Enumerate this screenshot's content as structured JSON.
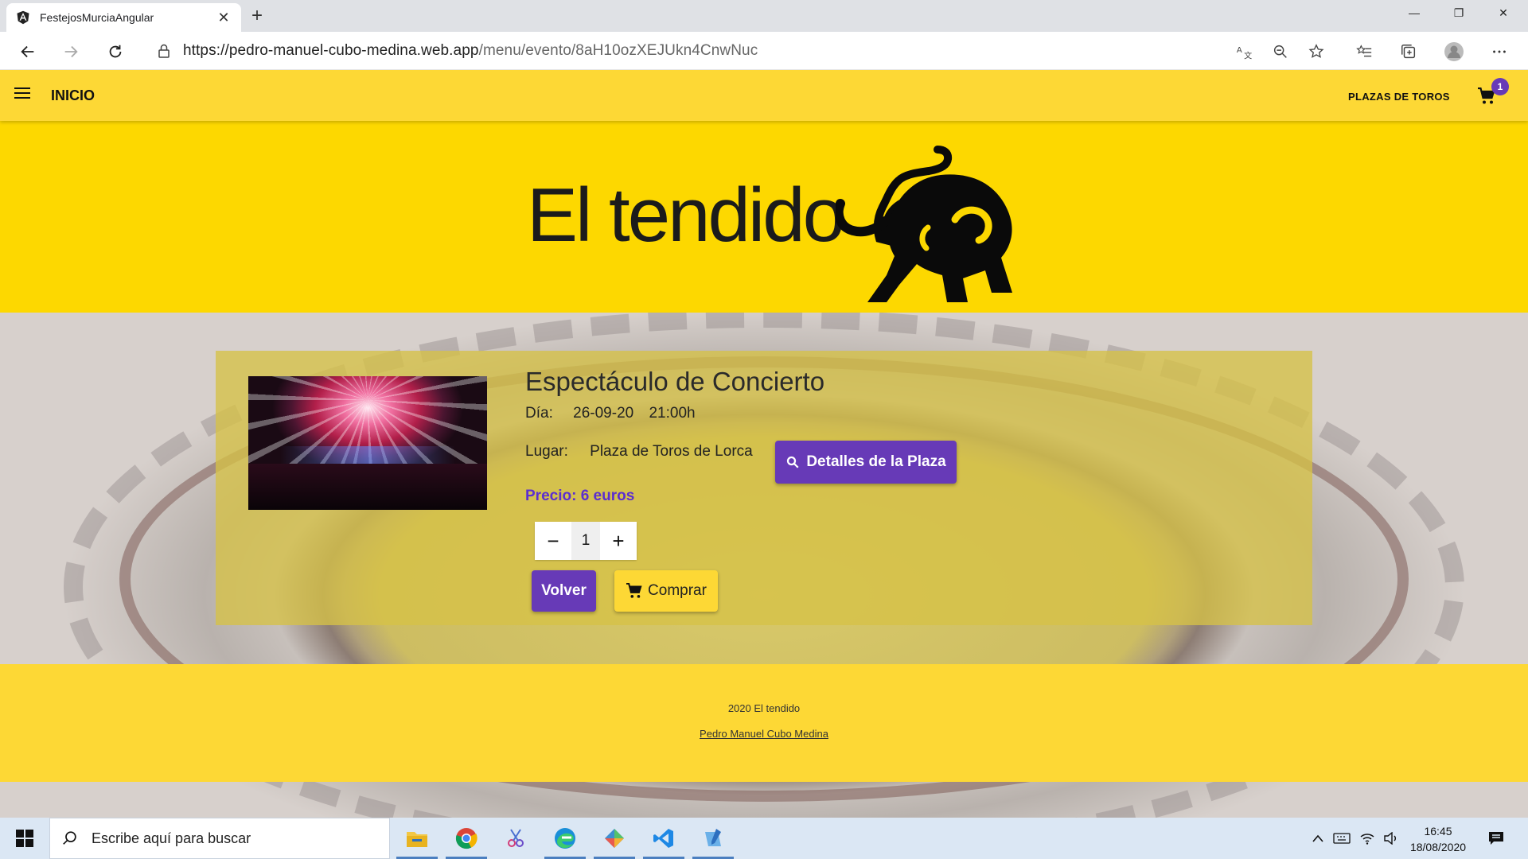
{
  "browser": {
    "tab_title": "FestejosMurciaAngular",
    "url_host": "https://pedro-manuel-cubo-medina.web.app",
    "url_path": "/menu/evento/8aH10ozXEJUkn4CnwNuc"
  },
  "site": {
    "nav": {
      "home_label": "INICIO",
      "plazas_label": "PLAZAS DE TOROS",
      "cart_count": "1"
    },
    "hero": {
      "logo_text": "El tendido"
    },
    "event": {
      "title": "Espectáculo de Concierto",
      "dia_label": "Día:",
      "date": "26-09-20",
      "time": "21:00h",
      "lugar_label": "Lugar:",
      "place": "Plaza de Toros de Lorca",
      "details_button": "Detalles de la Plaza",
      "price": "Precio: 6 euros",
      "quantity": "1",
      "back_button": "Volver",
      "buy_button": "Comprar"
    },
    "footer": {
      "copyright": "2020 El tendido",
      "author": "Pedro Manuel Cubo Medina"
    }
  },
  "taskbar": {
    "search_placeholder": "Escribe aquí para buscar",
    "time": "16:45",
    "date": "18/08/2020"
  },
  "colors": {
    "brand_yellow": "#fdd835",
    "accent_purple": "#673ab7",
    "price_purple": "#5b2ed0"
  }
}
